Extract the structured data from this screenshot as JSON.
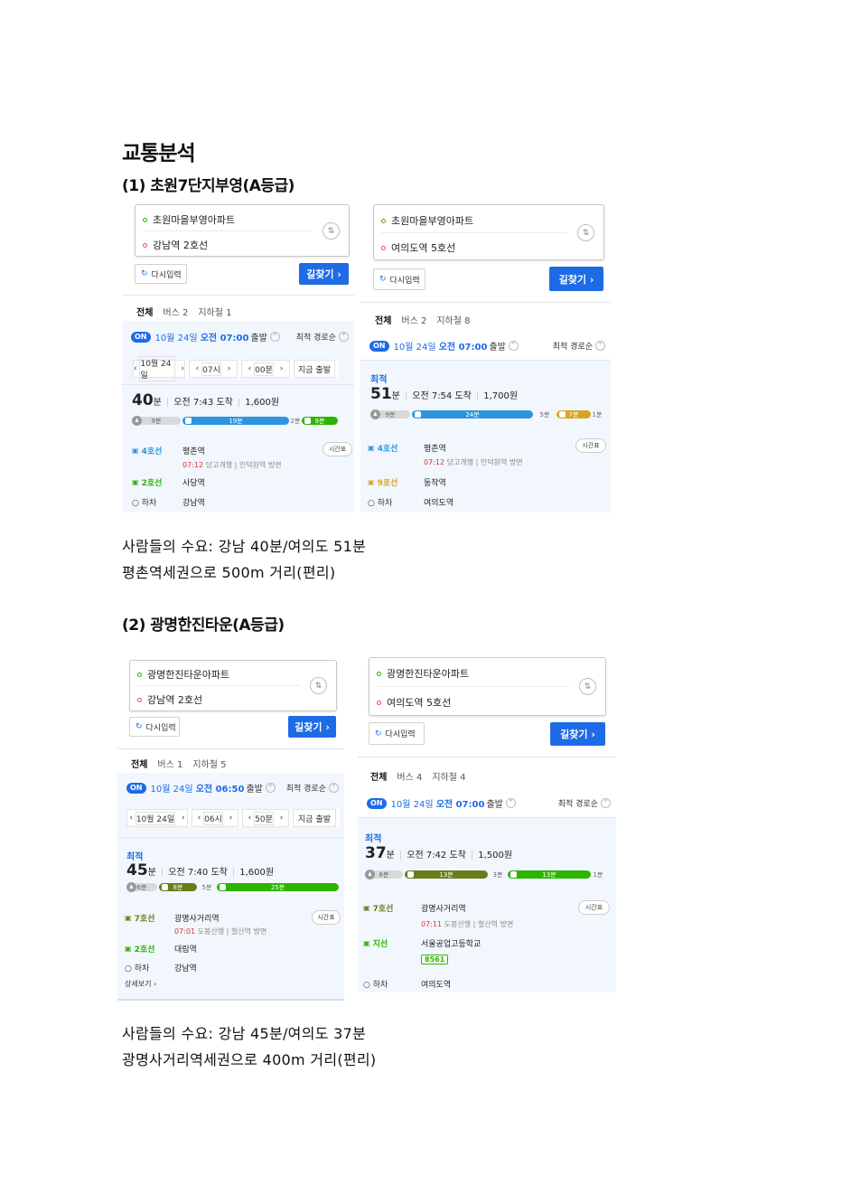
{
  "doc": {
    "title": "교통분석",
    "s1_title": "(1) 초원7단지부영(A등급)",
    "s1_line1": "사람들의 수요: 강남 40분/여의도 51분",
    "s1_line2": "평촌역세권으로 500m 거리(편리)",
    "s2_title": "(2) 광명한진타운(A등급)",
    "s2_line1": "사람들의 수요: 강남 45분/여의도 37분",
    "s2_line2": "광명사거리역세권으로 400m 거리(편리)"
  },
  "colors": {
    "primary": "#1e6be6",
    "line4": "#2d95de",
    "line2": "#2db400",
    "line9": "#d9a421",
    "line7": "#6a7d1b",
    "busBranch": "#2db400",
    "timeRed": "#e0322e"
  },
  "common": {
    "reinput": "다시입력",
    "find": "길찾기 ›",
    "sort": "최적 경로순",
    "on": "ON",
    "depart": "출발",
    "best": "최적",
    "min_unit": "분",
    "timetable": "시간표",
    "alight": "하차",
    "now_depart": "지금 출발",
    "more": "상세보기 ›"
  },
  "s1a": {
    "from": "초원마을부영아파트",
    "to": "강남역 2호선",
    "tabs": [
      "전체",
      "버스 2",
      "지하철 1"
    ],
    "date": "10월 24일",
    "time": "오전 07:00",
    "sel_date": "10월 24일",
    "sel_hour": "07시",
    "sel_min": "00분",
    "minutes": "40",
    "arrive": "오전 7:43 도착",
    "fare": "1,600원",
    "bar_labels": [
      "9분",
      "19분",
      "2분",
      "9분"
    ],
    "l1_line": "4호선",
    "l1_stn": "평촌역",
    "l1_time": "07:12",
    "l1_dir": "당고개행 | 인덕원역 방면",
    "l2_line": "2호선",
    "l2_stn": "사당역",
    "end_stn": "강남역"
  },
  "s1b": {
    "from": "초원마을부영아파트",
    "to": "여의도역 5호선",
    "tabs": [
      "전체",
      "버스 2",
      "지하철 8"
    ],
    "date": "10월 24일",
    "time": "오전 07:00",
    "minutes": "51",
    "arrive": "오전 7:54 도착",
    "fare": "1,700원",
    "bar_labels": [
      "9분",
      "24분",
      "5분",
      "7분",
      "1분"
    ],
    "l1_line": "4호선",
    "l1_stn": "평촌역",
    "l1_time": "07:12",
    "l1_dir": "당고개행 | 인덕원역 방면",
    "l2_line": "9호선",
    "l2_stn": "동작역",
    "end_stn": "여의도역"
  },
  "s2a": {
    "from": "광명한진타운아파트",
    "to": "강남역 2호선",
    "tabs": [
      "전체",
      "버스 1",
      "지하철 5"
    ],
    "date": "10월 24일",
    "time": "오전 06:50",
    "sel_date": "10월 24일",
    "sel_hour": "06시",
    "sel_min": "50분",
    "minutes": "45",
    "arrive": "오전 7:40 도착",
    "fare": "1,600원",
    "bar_labels": [
      "6분",
      "8분",
      "5분",
      "25분"
    ],
    "l1_line": "7호선",
    "l1_stn": "광명사거리역",
    "l1_time": "07:01",
    "l1_dir": "도봉산행 | 철산역 방면",
    "l2_line": "2호선",
    "l2_stn": "대림역",
    "end_stn": "강남역"
  },
  "s2b": {
    "from": "광명한진타운아파트",
    "to": "여의도역 5호선",
    "tabs": [
      "전체",
      "버스 4",
      "지하철 4"
    ],
    "date": "10월 24일",
    "time": "오전 07:00",
    "minutes": "37",
    "arrive": "오전 7:42 도착",
    "fare": "1,500원",
    "bar_labels": [
      "6분",
      "13분",
      "3분",
      "13분",
      "1분"
    ],
    "l1_line": "7호선",
    "l1_stn": "광명사거리역",
    "l1_time": "07:11",
    "l1_dir": "도봉산행 | 철산역 방면",
    "l2_line": "지선",
    "l2_stn": "서울공업고등학교",
    "bus_no": "8561",
    "end_stn": "여의도역"
  }
}
